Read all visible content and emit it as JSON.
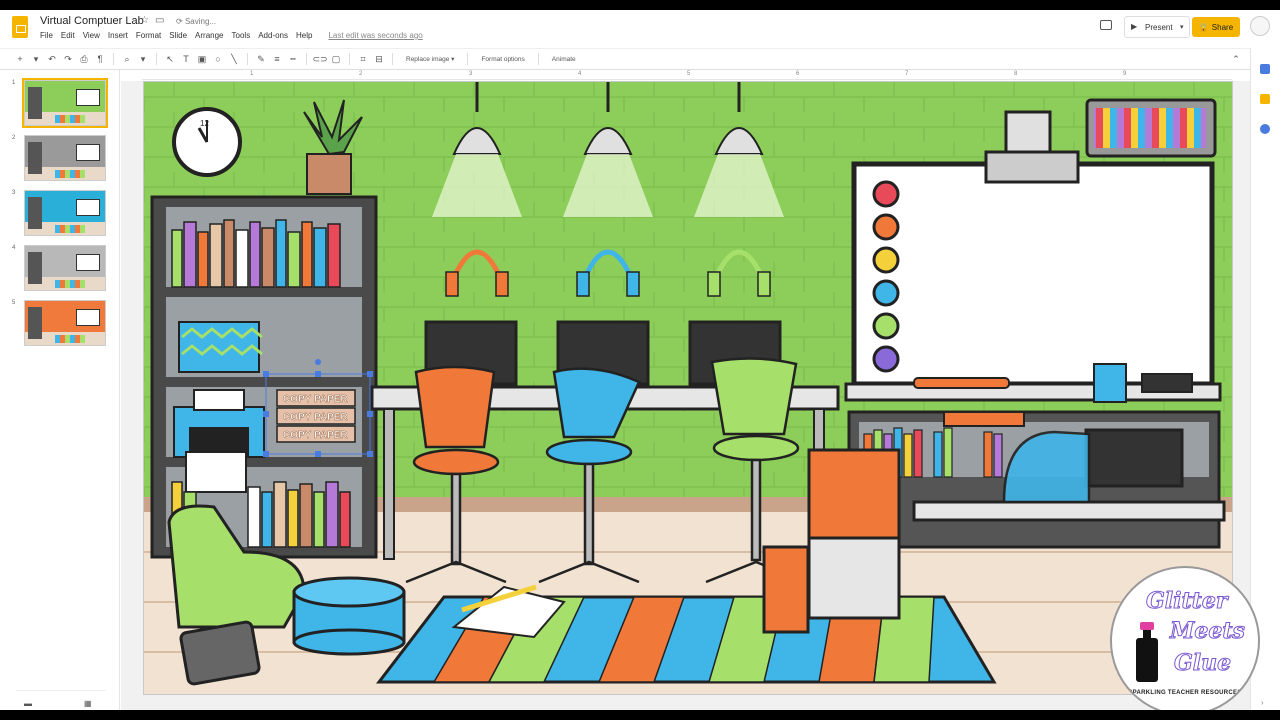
{
  "app": {
    "doc_title": "Virtual Comptuer Lab",
    "saving_text": "Saving...",
    "menu": [
      "File",
      "Edit",
      "View",
      "Insert",
      "Format",
      "Slide",
      "Arrange",
      "Tools",
      "Add-ons",
      "Help"
    ],
    "last_edit": "Last edit was seconds ago",
    "present_label": "Present",
    "share_label": "Share"
  },
  "toolbar": {
    "replace_image": "Replace image ▾",
    "format_options": "Format options",
    "animate": "Animate"
  },
  "ruler": [
    "1",
    "2",
    "3",
    "4",
    "5",
    "6",
    "7",
    "8",
    "9"
  ],
  "filmstrip": {
    "slides": [
      {
        "num": "1",
        "wall": "#8dce5a",
        "active": true
      },
      {
        "num": "2",
        "wall": "#9a9a9a",
        "active": false
      },
      {
        "num": "3",
        "wall": "#2ab0d8",
        "active": false
      },
      {
        "num": "4",
        "wall": "#b8b8b8",
        "active": false
      },
      {
        "num": "5",
        "wall": "#f07a3c",
        "active": false
      }
    ]
  },
  "slide": {
    "paper_labels": [
      "COPY PAPER",
      "COPY PAPER",
      "COPY PAPER"
    ],
    "clock_text": "12"
  },
  "logo": {
    "line1": "Glitter",
    "line2": "Meets",
    "line3": "Glue",
    "sub": "SPARKLING TEACHER RESOURCES"
  },
  "colors": {
    "wall": "#8dce5a",
    "orange": "#f0793a",
    "blue": "#3fb5e8",
    "green": "#a6e06a",
    "accent": "#f4b400"
  }
}
